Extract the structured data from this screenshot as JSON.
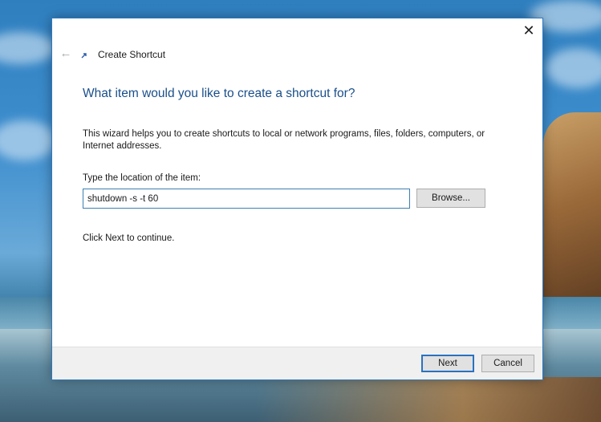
{
  "dialog": {
    "title": "Create Shortcut",
    "close_glyph": "✕",
    "back_glyph": "←",
    "heading": "What item would you like to create a shortcut for?",
    "description": "This wizard helps you to create shortcuts to local or network programs, files, folders, computers, or Internet addresses.",
    "location_label": "Type the location of the item:",
    "location_value": "shutdown -s -t 60",
    "browse_label": "Browse...",
    "continue_text": "Click Next to continue.",
    "next_label": "Next",
    "cancel_label": "Cancel"
  },
  "icons": {
    "close": "close-icon",
    "back": "back-arrow-icon",
    "wizard": "shortcut-icon"
  },
  "colors": {
    "accent": "#2b78c4",
    "heading": "#1a4f8a",
    "footer_bg": "#f0f0f0",
    "button_bg": "#e1e1e1"
  }
}
